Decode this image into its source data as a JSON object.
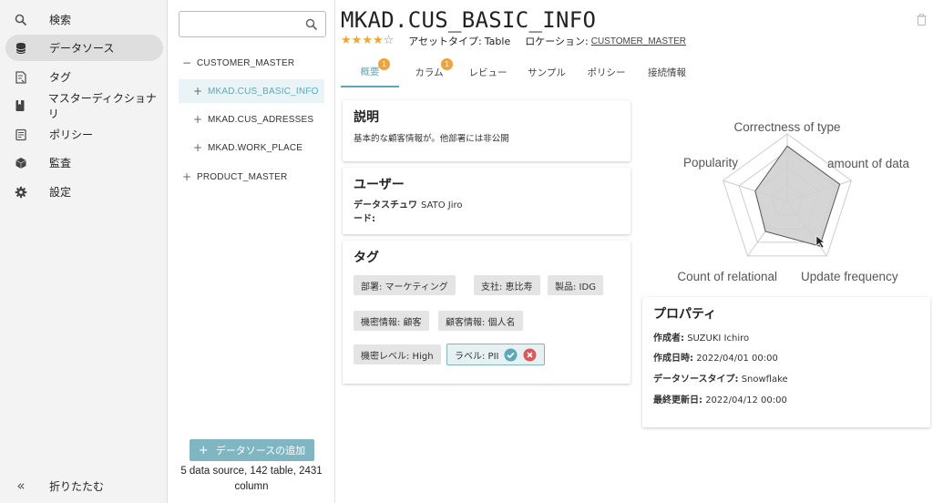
{
  "nav": {
    "items": [
      {
        "label": "検索",
        "icon": "search-icon"
      },
      {
        "label": "データソース",
        "icon": "database-icon",
        "active": true
      },
      {
        "label": "タグ",
        "icon": "tag-icon"
      },
      {
        "label": "マスターディクショナリ",
        "icon": "dictionary-icon"
      },
      {
        "label": "ポリシー",
        "icon": "policy-icon"
      },
      {
        "label": "監査",
        "icon": "audit-icon"
      },
      {
        "label": "設定",
        "icon": "gear-icon"
      }
    ],
    "collapse": {
      "icon": "«",
      "label": "折りたたむ"
    }
  },
  "tree": {
    "search_placeholder": "",
    "nodes": [
      {
        "toggle": "−",
        "label": "CUSTOMER_MASTER"
      },
      {
        "toggle": "+",
        "label": "MKAD.CUS_BASIC_INFO",
        "selected": true
      },
      {
        "toggle": "+",
        "label": "MKAD.CUS_ADRESSES"
      },
      {
        "toggle": "+",
        "label": "MKAD.WORK_PLACE"
      },
      {
        "toggle": "+",
        "label": "PRODUCT_MASTER"
      }
    ],
    "add_button": {
      "plus": "+",
      "label": "データソースの追加"
    },
    "stats": "5 data source, 142 table, 2431 column"
  },
  "header": {
    "title": "MKAD.CUS_BASIC_INFO",
    "rating": 4,
    "rating_max": 5,
    "asset_type_label": "アセットタイプ:",
    "asset_type_value": "Table",
    "location_label": "ロケーション:",
    "location_value": "CUSTOMER_MASTER"
  },
  "tabs": [
    {
      "label": "概要",
      "badge": "1",
      "active": true
    },
    {
      "label": "カラム",
      "badge": "1"
    },
    {
      "label": "レビュー"
    },
    {
      "label": "サンプル"
    },
    {
      "label": "ポリシー"
    },
    {
      "label": "接続情報"
    }
  ],
  "description": {
    "title": "説明",
    "text": "基本的な顧客情報が。他部署には非公開"
  },
  "users": {
    "title": "ユーザー",
    "steward_label_line1": "データスチュワ",
    "steward_label_line2": "ード:",
    "steward_value": "SATO Jiro"
  },
  "tags": {
    "title": "タグ",
    "items": [
      "部署: マーケティング",
      "支社: 恵比寿",
      "製品: IDG",
      "機密情報: 顧客",
      "顧客情報: 個人名",
      "機密レベル: High",
      "ラベル: PII"
    ]
  },
  "radar": {
    "axes": [
      "Correctness of type",
      "amount of data",
      "Update frequency",
      "Count of relational",
      "Popularity"
    ],
    "values": [
      0.82,
      0.82,
      0.82,
      0.55,
      0.5
    ]
  },
  "properties": {
    "title": "プロパティ",
    "rows": [
      {
        "label": "作成者:",
        "value": "SUZUKI Ichiro"
      },
      {
        "label": "作成日時:",
        "value": "2022/04/01 00:00"
      },
      {
        "label": "データソースタイプ:",
        "value": "Snowflake"
      },
      {
        "label": "最終更新日:",
        "value": "2022/04/12 00:00"
      }
    ]
  },
  "colors": {
    "accent": "#5aa9b8",
    "badge": "#f0a33a",
    "star": "#f5a623",
    "approve": "#5aa9b8",
    "reject": "#e05555"
  }
}
